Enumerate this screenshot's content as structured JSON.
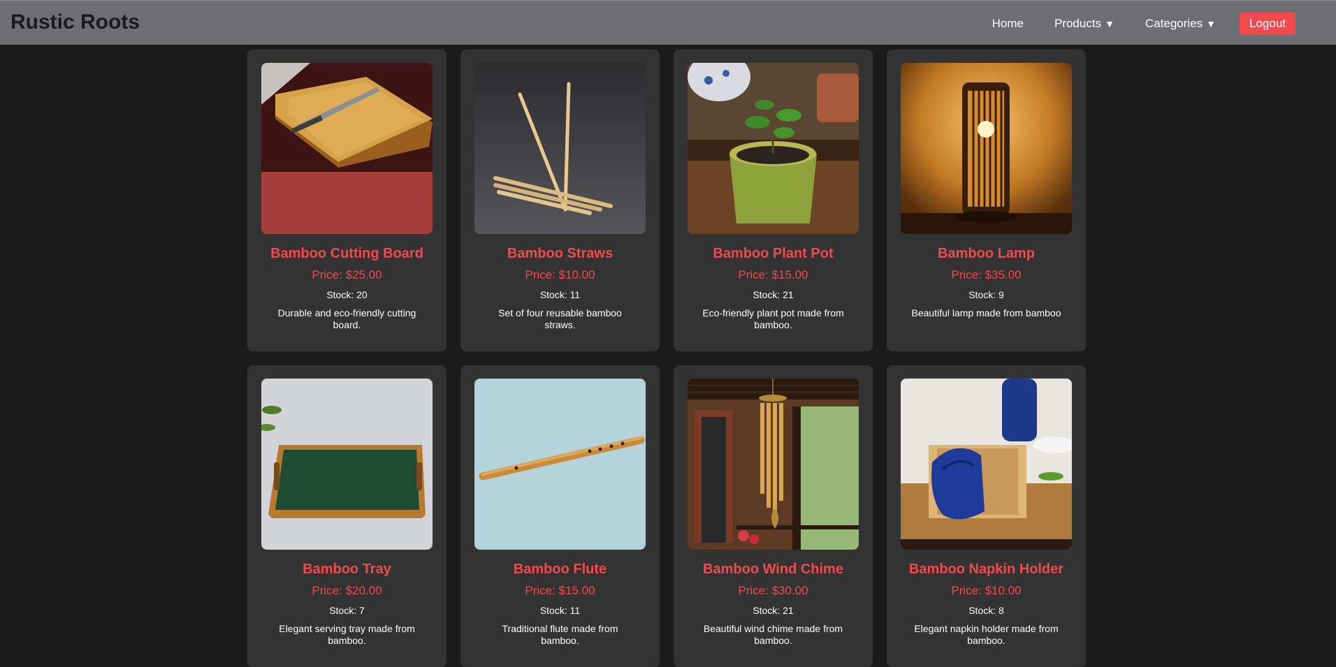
{
  "brand": "Rustic Roots",
  "nav": {
    "home": "Home",
    "products": "Products",
    "categories": "Categories",
    "caret": "▼",
    "logout": "Logout"
  },
  "products": [
    {
      "name": "Bamboo Cutting Board",
      "price": "Price: $25.00",
      "stock": "Stock: 20",
      "description": "Durable and eco-friendly cutting board."
    },
    {
      "name": "Bamboo Straws",
      "price": "Price: $10.00",
      "stock": "Stock: 11",
      "description": "Set of four reusable bamboo straws."
    },
    {
      "name": "Bamboo Plant Pot",
      "price": "Price: $15.00",
      "stock": "Stock: 21",
      "description": "Eco-friendly plant pot made from bamboo."
    },
    {
      "name": "Bamboo Lamp",
      "price": "Price: $35.00",
      "stock": "Stock: 9",
      "description": "Beautiful lamp made from bamboo"
    },
    {
      "name": "Bamboo Tray",
      "price": "Price: $20.00",
      "stock": "Stock: 7",
      "description": "Elegant serving tray made from bamboo."
    },
    {
      "name": "Bamboo Flute",
      "price": "Price: $15.00",
      "stock": "Stock: 11",
      "description": "Traditional flute made from bamboo."
    },
    {
      "name": "Bamboo Wind Chime",
      "price": "Price: $30.00",
      "stock": "Stock: 21",
      "description": "Beautiful wind chime made from bamboo."
    },
    {
      "name": "Bamboo Napkin Holder",
      "price": "Price: $10.00",
      "stock": "Stock: 8",
      "description": "Elegant napkin holder made from bamboo."
    }
  ],
  "colors": {
    "accent": "#f04a4e",
    "navbar": "#6e6d72",
    "background": "#1b1b1b",
    "card": "#333333"
  }
}
